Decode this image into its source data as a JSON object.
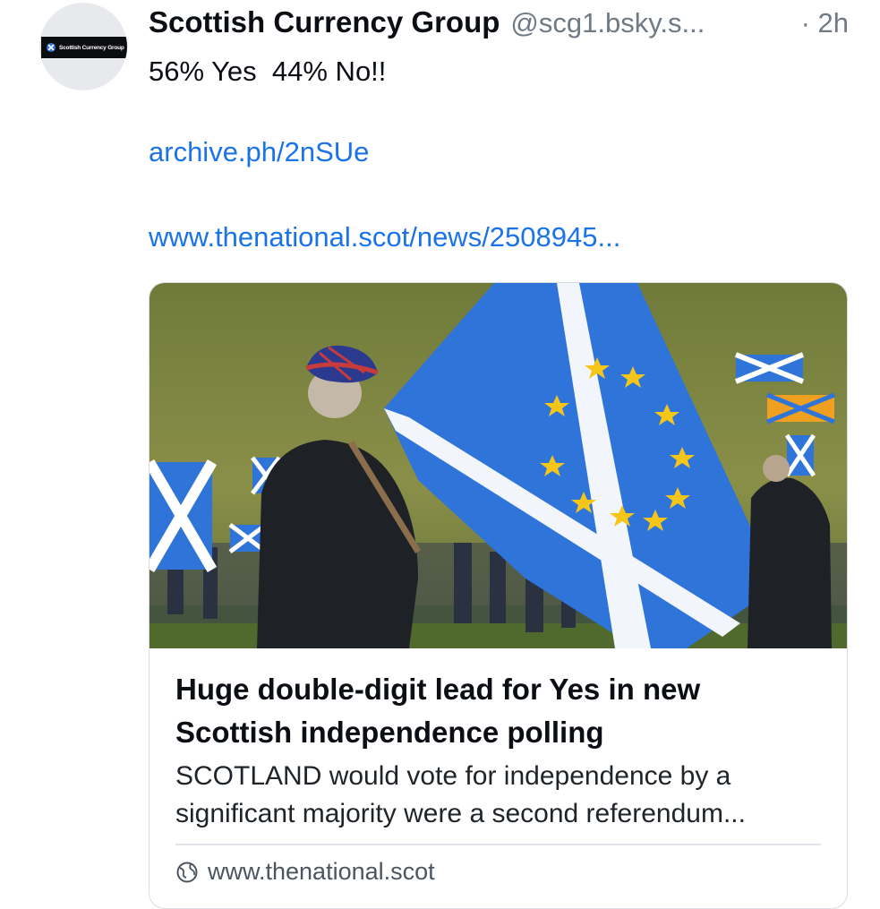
{
  "post": {
    "author_name": "Scottish Currency Group",
    "handle": "@scg1.bsky.s...",
    "time": "· 2h",
    "avatar_logo_text": "Scottish Currency Group",
    "text": "56% Yes  44% No!!",
    "links": [
      "archive.ph/2nSUe",
      "www.thenational.scot/news/2508945..."
    ]
  },
  "card": {
    "image_icon": "photo-scotland-eu-flag-rally",
    "title": "Huge double-digit lead for Yes in new Scottish independence polling",
    "description": "SCOTLAND would vote for independence by a significant majority were a second referendum...",
    "domain": "www.thenational.scot",
    "domain_icon": "globe-icon"
  },
  "colors": {
    "link": "#1a73e8",
    "muted": "#6f7a86",
    "flag_blue": "#2f74d9"
  }
}
